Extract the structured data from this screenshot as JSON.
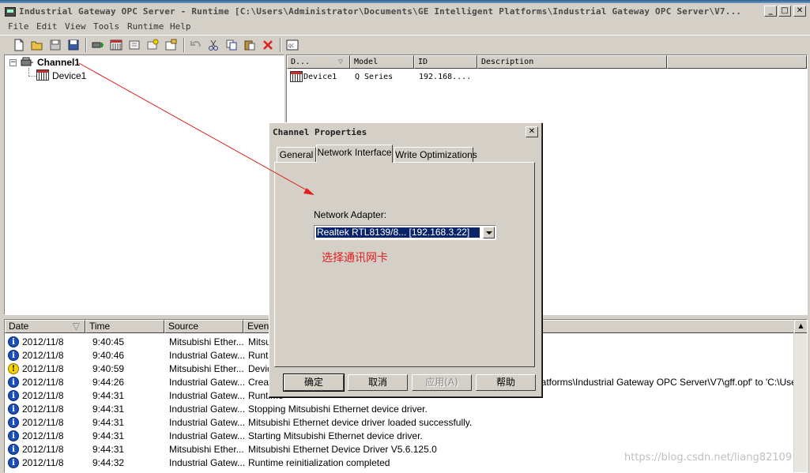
{
  "window": {
    "title": "Industrial Gateway OPC Server - Runtime [C:\\Users\\Administrator\\Documents\\GE Intelligent Platforms\\Industrial Gateway OPC Server\\V7...",
    "min_glyph": "_",
    "max_glyph": "□",
    "close_glyph": "✕"
  },
  "menu": [
    "File",
    "Edit",
    "View",
    "Tools",
    "Runtime",
    "Help"
  ],
  "toolbar_icons": [
    "new-icon",
    "open-icon",
    "save-icon",
    "save-as-icon",
    "new-channel-icon",
    "new-device-icon",
    "new-group-icon",
    "new-tag-icon",
    "properties-icon",
    "undo-icon",
    "cut-icon",
    "copy-icon",
    "paste-icon",
    "delete-icon",
    "quick-client-icon"
  ],
  "tree": {
    "expander": "−",
    "channel": "Channel1",
    "device": "Device1"
  },
  "device_list": {
    "columns": [
      "D...",
      "Model",
      "ID",
      "Description"
    ],
    "rows": [
      {
        "name": "Device1",
        "model": "Q Series",
        "id": "192.168....",
        "description": ""
      }
    ]
  },
  "event_log": {
    "columns": [
      "Date",
      "Time",
      "Source",
      "Event"
    ],
    "rows": [
      {
        "type": "info",
        "date": "2012/11/8",
        "time": "9:40:45",
        "source": "Mitsubishi Ether...",
        "event": "Mitsu"
      },
      {
        "type": "info",
        "date": "2012/11/8",
        "time": "9:40:46",
        "source": "Industrial Gatew...",
        "event": "Runti"
      },
      {
        "type": "warning",
        "date": "2012/11/8",
        "time": "9:40:59",
        "source": "Mitsubishi Ether...",
        "event": "Devic"
      },
      {
        "type": "info",
        "date": "2012/11/8",
        "time": "9:44:26",
        "source": "Industrial Gatew...",
        "event": "Create",
        "event_tail": "latforms\\Industrial Gateway OPC Server\\V7\\gff.opf' to 'C:\\Users\\Ac"
      },
      {
        "type": "info",
        "date": "2012/11/8",
        "time": "9:44:31",
        "source": "Industrial Gatew...",
        "event": "Runtime"
      },
      {
        "type": "info",
        "date": "2012/11/8",
        "time": "9:44:31",
        "source": "Industrial Gatew...",
        "event": "Stopping Mitsubishi Ethernet device driver."
      },
      {
        "type": "info",
        "date": "2012/11/8",
        "time": "9:44:31",
        "source": "Industrial Gatew...",
        "event": "Mitsubishi Ethernet device driver loaded successfully."
      },
      {
        "type": "info",
        "date": "2012/11/8",
        "time": "9:44:31",
        "source": "Industrial Gatew...",
        "event": "Starting Mitsubishi Ethernet device driver."
      },
      {
        "type": "info",
        "date": "2012/11/8",
        "time": "9:44:31",
        "source": "Mitsubishi Ether...",
        "event": "Mitsubishi Ethernet Device Driver V5.6.125.0"
      },
      {
        "type": "info",
        "date": "2012/11/8",
        "time": "9:44:32",
        "source": "Industrial Gatew...",
        "event": "Runtime reinitialization completed"
      }
    ]
  },
  "dialog": {
    "title": "Channel Properties",
    "close_glyph": "✕",
    "tabs": [
      "General",
      "Network Interface",
      "Write Optimizations"
    ],
    "active_tab": "Network Interface",
    "network_adapter_label": "Network Adapter:",
    "network_adapter_value": "Realtek RTL8139/8... [192.168.3.22]",
    "annotation": "选择通讯网卡",
    "annotation_color": "#e02020",
    "buttons": {
      "ok": "确定",
      "cancel": "取消",
      "apply": "应用(A)",
      "help": "帮助"
    }
  },
  "watermark": "https://blog.csdn.net/liang82109",
  "colors": {
    "arrow": "#e02020",
    "selection": "#0a246a",
    "info_icon": "#1a4fb8",
    "warning_icon": "#f3d400"
  }
}
